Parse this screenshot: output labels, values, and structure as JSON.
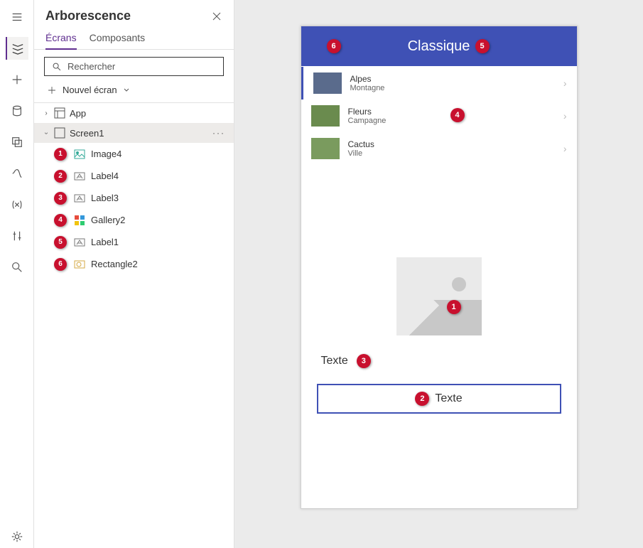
{
  "panel": {
    "title": "Arborescence",
    "tabs": {
      "screens": "Écrans",
      "components": "Composants"
    },
    "search_placeholder": "Rechercher",
    "new_screen": "Nouvel écran",
    "app": "App",
    "screen": "Screen1",
    "items": [
      {
        "num": "1",
        "label": "Image4",
        "icon": "image"
      },
      {
        "num": "2",
        "label": "Label4",
        "icon": "label"
      },
      {
        "num": "3",
        "label": "Label3",
        "icon": "label"
      },
      {
        "num": "4",
        "label": "Gallery2",
        "icon": "gallery"
      },
      {
        "num": "5",
        "label": "Label1",
        "icon": "label"
      },
      {
        "num": "6",
        "label": "Rectangle2",
        "icon": "rect"
      }
    ]
  },
  "phone": {
    "title": "Classique",
    "rows": [
      {
        "title": "Alpes",
        "sub": "Montagne",
        "color": "#5a6b8c"
      },
      {
        "title": "Fleurs",
        "sub": "Campagne",
        "color": "#6a8b4e"
      },
      {
        "title": "Cactus",
        "sub": "Ville",
        "color": "#7a9b5e"
      }
    ],
    "label3": "Texte",
    "label4": "Texte",
    "badges": {
      "head_left": "6",
      "head_right": "5",
      "gallery": "4",
      "image": "1",
      "label3": "3",
      "label4": "2"
    }
  }
}
